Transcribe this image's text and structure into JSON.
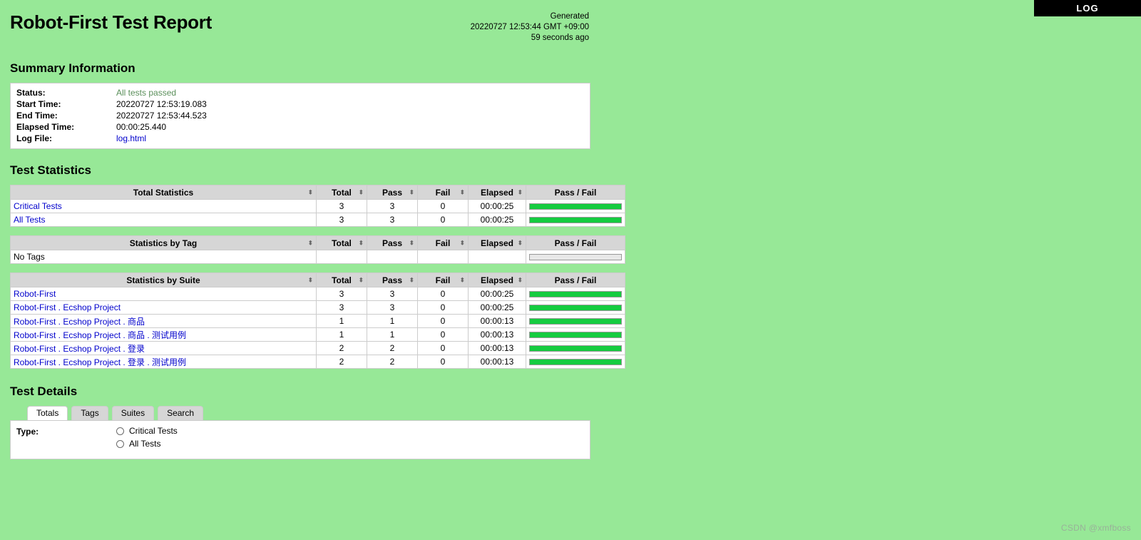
{
  "log_button": {
    "label": "LOG"
  },
  "header": {
    "title": "Robot-First Test Report",
    "generated_label": "Generated",
    "generated_time": "20220727 12:53:44 GMT +09:00",
    "generated_ago": "59 seconds ago"
  },
  "summary": {
    "heading": "Summary Information",
    "rows": [
      {
        "label": "Status:",
        "value": "All tests passed",
        "kind": "status-pass"
      },
      {
        "label": "Start Time:",
        "value": "20220727 12:53:19.083",
        "kind": "plain"
      },
      {
        "label": "End Time:",
        "value": "20220727 12:53:44.523",
        "kind": "plain"
      },
      {
        "label": "Elapsed Time:",
        "value": "00:00:25.440",
        "kind": "plain"
      },
      {
        "label": "Log File:",
        "value": "log.html",
        "kind": "link"
      }
    ]
  },
  "statistics": {
    "heading": "Test Statistics",
    "columns": {
      "total": "Total",
      "pass": "Pass",
      "fail": "Fail",
      "elapsed": "Elapsed",
      "passfail": "Pass / Fail"
    },
    "sort_icon": "sort-arrows",
    "tables": [
      {
        "title": "Total Statistics",
        "rows": [
          {
            "name": "Critical Tests",
            "link": true,
            "total": "3",
            "pass": "3",
            "fail": "0",
            "elapsed": "00:00:25",
            "pass_pct": 100,
            "fail_pct": 0,
            "bar": true
          },
          {
            "name": "All Tests",
            "link": true,
            "total": "3",
            "pass": "3",
            "fail": "0",
            "elapsed": "00:00:25",
            "pass_pct": 100,
            "fail_pct": 0,
            "bar": true
          }
        ]
      },
      {
        "title": "Statistics by Tag",
        "rows": [
          {
            "name": "No Tags",
            "link": false,
            "total": "",
            "pass": "",
            "fail": "",
            "elapsed": "",
            "pass_pct": 0,
            "fail_pct": 0,
            "bar": true
          }
        ]
      },
      {
        "title": "Statistics by Suite",
        "rows": [
          {
            "name": "Robot-First",
            "link": true,
            "total": "3",
            "pass": "3",
            "fail": "0",
            "elapsed": "00:00:25",
            "pass_pct": 100,
            "fail_pct": 0,
            "bar": true
          },
          {
            "name": "Robot-First . Ecshop Project",
            "link": true,
            "total": "3",
            "pass": "3",
            "fail": "0",
            "elapsed": "00:00:25",
            "pass_pct": 100,
            "fail_pct": 0,
            "bar": true
          },
          {
            "name": "Robot-First . Ecshop Project . 商品",
            "link": true,
            "total": "1",
            "pass": "1",
            "fail": "0",
            "elapsed": "00:00:13",
            "pass_pct": 100,
            "fail_pct": 0,
            "bar": true
          },
          {
            "name": "Robot-First . Ecshop Project . 商品 . 测试用例",
            "link": true,
            "total": "1",
            "pass": "1",
            "fail": "0",
            "elapsed": "00:00:13",
            "pass_pct": 100,
            "fail_pct": 0,
            "bar": true
          },
          {
            "name": "Robot-First . Ecshop Project . 登录",
            "link": true,
            "total": "2",
            "pass": "2",
            "fail": "0",
            "elapsed": "00:00:13",
            "pass_pct": 100,
            "fail_pct": 0,
            "bar": true
          },
          {
            "name": "Robot-First . Ecshop Project . 登录 . 测试用例",
            "link": true,
            "total": "2",
            "pass": "2",
            "fail": "0",
            "elapsed": "00:00:13",
            "pass_pct": 100,
            "fail_pct": 0,
            "bar": true
          }
        ]
      }
    ]
  },
  "details": {
    "heading": "Test Details",
    "tabs": [
      {
        "label": "Totals",
        "active": true
      },
      {
        "label": "Tags",
        "active": false
      },
      {
        "label": "Suites",
        "active": false
      },
      {
        "label": "Search",
        "active": false
      }
    ],
    "type_label": "Type:",
    "options": [
      {
        "label": "Critical Tests",
        "selected": false
      },
      {
        "label": "All Tests",
        "selected": false
      }
    ]
  },
  "watermark": {
    "text": "CSDN @xmfboss"
  },
  "colors": {
    "background": "#97e897",
    "pass_bar": "#15cc40",
    "fail_bar": "#e03030",
    "link": "#0000cc",
    "status_pass": "#5a8f5a",
    "header_bg": "#d6d6d6",
    "log_bar_bg": "#000000"
  }
}
